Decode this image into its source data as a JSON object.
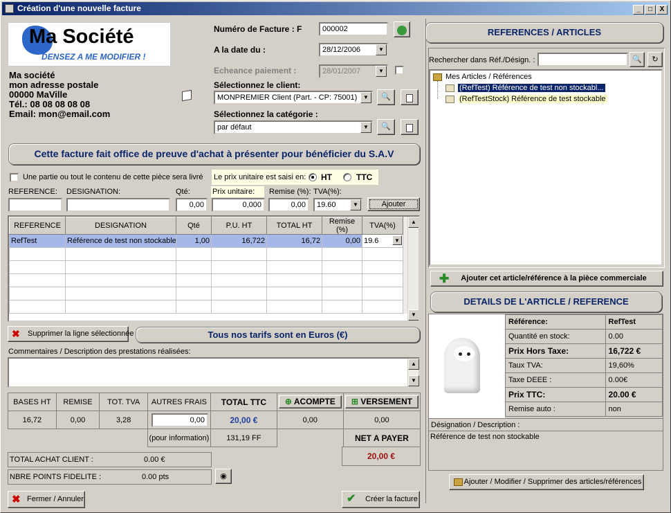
{
  "window": {
    "title": "Création d'une nouvelle facture",
    "min": "_",
    "max": "□",
    "close": "X"
  },
  "company": {
    "logo_name": "Ma Société",
    "logo_tagline": "DENSEZ A ME MODIFIER !",
    "line1": "Ma société",
    "line2": "mon adresse postale",
    "line3": "00000 MaVille",
    "line4": "Tél.: 08 08 08 08 08",
    "line5": "Email: mon@email.com"
  },
  "invoice": {
    "number_label": "Numéro de Facture : F",
    "number_value": "000002",
    "date_label": "A la date du :",
    "date_value": "28/12/2006",
    "due_label": "Echeance paiement :",
    "due_value": "28/01/2007",
    "client_label": "Sélectionnez le client:",
    "client_value": "MONPREMIER Client (Part. - CP: 75001)",
    "category_label": "Sélectionnez la catégorie :",
    "category_value": "par défaut"
  },
  "sav_banner": "Cette facture fait office de preuve d'achat à présenter pour bénéficier du S.A.V",
  "options": {
    "partial_delivery": "Une partie ou tout le contenu de cette pièce sera livré",
    "price_mode_label": "Le prix unitaire est saisi en:",
    "ht": "HT",
    "ttc": "TTC"
  },
  "entry": {
    "ref_label": "REFERENCE:",
    "desig_label": "DESIGNATION:",
    "qty_label": "Qté:",
    "unit_label": "Prix unitaire:",
    "remise_label": "Remise (%):",
    "tva_label": "TVA(%):",
    "qty_value": "0,00",
    "unit_value": "0,000",
    "remise_value": "0,00",
    "tva_value": "19.60",
    "add_button": "Ajouter"
  },
  "lines_table": {
    "headers": [
      "REFERENCE",
      "DESIGNATION",
      "Qté",
      "P.U. HT",
      "TOTAL HT",
      "Remise (%)",
      "TVA(%)"
    ],
    "rows": [
      [
        "RefTest",
        "Référence de test non stockable",
        "1,00",
        "16,722",
        "16,72",
        "0,00",
        "19.6"
      ]
    ]
  },
  "delete_line_button": "Supprimer la ligne sélectionnée",
  "euro_banner": "Tous nos tarifs sont en Euros (€)",
  "comments_label": "Commentaires / Description des prestations réalisées:",
  "totals": {
    "bases_ht_label": "BASES HT",
    "remise_label": "REMISE",
    "tot_tva_label": "TOT. TVA",
    "autres_frais_label": "AUTRES FRAIS",
    "total_ttc_label": "TOTAL TTC",
    "acompte_label": "ACOMPTE",
    "versement_label": "VERSEMENT",
    "bases_ht": "16,72",
    "remise": "0,00",
    "tot_tva": "3,28",
    "autres_frais": "0,00",
    "total_ttc": "20,00 €",
    "acompte": "0,00",
    "versement": "0,00",
    "info_label": "(pour information)",
    "ttc_ff": "131,19 FF",
    "net_label": "NET A PAYER",
    "net_value": "20,00 €"
  },
  "client_stats": {
    "total_achat_label": "TOTAL ACHAT CLIENT :",
    "total_achat": "0.00 €",
    "points_label": "NBRE POINTS FIDELITE :",
    "points": "0.00 pts"
  },
  "footer": {
    "close_button": "Fermer / Annuler",
    "create_button": "Créer la facture"
  },
  "references": {
    "title": "REFERENCES / ARTICLES",
    "search_label": "Rechercher dans Réf./Désign. :",
    "tree_root": "Mes Articles / Références",
    "items": [
      "(RefTest) Référence de test non stockabl...",
      "(RefTestStock) Référence de test stockable"
    ],
    "add_button": "Ajouter cet article/référence à la pièce commerciale"
  },
  "details": {
    "title": "DETAILS DE L'ARTICLE / REFERENCE",
    "rows": [
      [
        "Référence:",
        "RefTest"
      ],
      [
        "Quantité en stock:",
        "0.00"
      ],
      [
        "Prix Hors Taxe:",
        "16,722 €"
      ],
      [
        "Taux TVA:",
        "19,60%"
      ],
      [
        "Taxe DEEE :",
        "0.00€"
      ],
      [
        "Prix TTC:",
        "20.00 €"
      ],
      [
        "Remise auto :",
        "non"
      ]
    ],
    "desc_label": "Désignation / Description :",
    "desc_value": "Référence de test non stockable",
    "manage_button": "Ajouter / Modifier / Supprimer des articles/références"
  },
  "colors": {
    "title_start": "#0a246a",
    "banner_text": "#0a246a",
    "selection": "#0a246a",
    "total_blue": "#1f3fa0",
    "net_red": "#a01010"
  }
}
